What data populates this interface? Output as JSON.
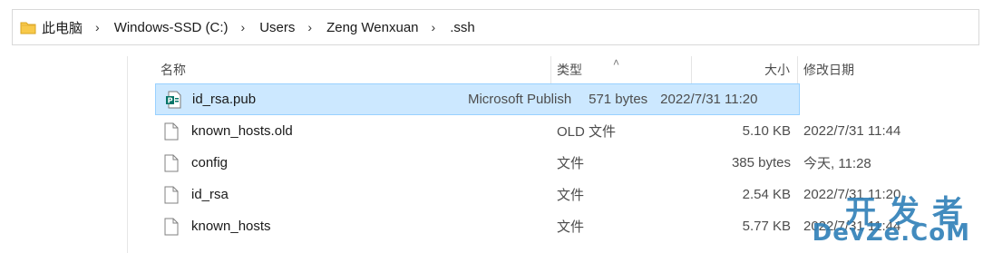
{
  "address_bar": {
    "crumbs": [
      "此电脑",
      "Windows-SSD (C:)",
      "Users",
      "Zeng Wenxuan",
      ".ssh"
    ]
  },
  "columns": {
    "name": "名称",
    "type": "类型",
    "size": "大小",
    "date": "修改日期"
  },
  "files": [
    {
      "name": "id_rsa.pub",
      "type": "Microsoft Publish...",
      "size": "571 bytes",
      "date": "2022/7/31 11:20",
      "icon": "publisher-file-icon",
      "selected": true
    },
    {
      "name": "known_hosts.old",
      "type": "OLD 文件",
      "size": "5.10 KB",
      "date": "2022/7/31 11:44",
      "icon": "file-icon"
    },
    {
      "name": "config",
      "type": "文件",
      "size": "385 bytes",
      "date": "今天, 11:28",
      "icon": "file-icon"
    },
    {
      "name": "id_rsa",
      "type": "文件",
      "size": "2.54 KB",
      "date": "2022/7/31 11:20",
      "icon": "file-icon"
    },
    {
      "name": "known_hosts",
      "type": "文件",
      "size": "5.77 KB",
      "date": "2022/7/31 11:44",
      "icon": "file-icon"
    }
  ],
  "watermark": {
    "cn": "开发者",
    "en": "DevZe.CoM"
  },
  "colors": {
    "selection_bg": "#cce8ff",
    "selection_border": "#99d1ff",
    "folder": "#f8c94a",
    "watermark": "#2e7fb8"
  }
}
